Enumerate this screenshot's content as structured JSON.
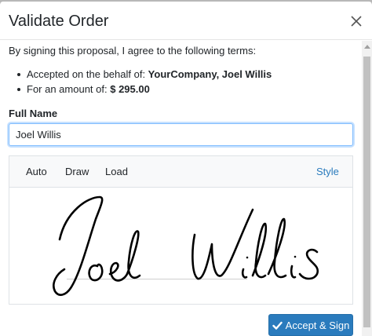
{
  "modal": {
    "title": "Validate Order",
    "close_icon": "close-icon"
  },
  "body": {
    "intro": "By signing this proposal, I agree to the following terms:",
    "terms": [
      {
        "prefix": "Accepted on the behalf of: ",
        "value": "YourCompany, Joel Willis"
      },
      {
        "prefix": "For an amount of: ",
        "value": "$ 295.00"
      }
    ]
  },
  "form": {
    "name_label": "Full Name",
    "name_value": "Joel Willis"
  },
  "signature": {
    "tabs": [
      "Auto",
      "Draw",
      "Load"
    ],
    "style_link": "Style"
  },
  "footer": {
    "accept_label": "Accept & Sign",
    "accept_icon": "check-icon",
    "accent_color": "#2a7bbd"
  }
}
